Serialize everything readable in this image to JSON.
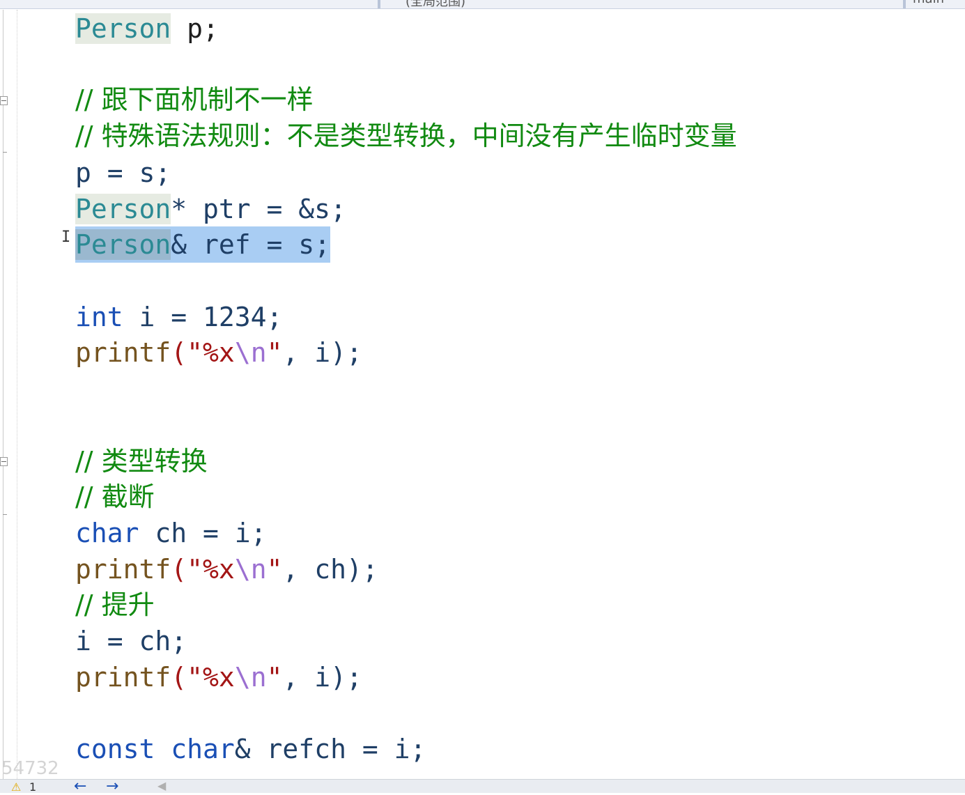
{
  "tabs": {
    "left_partial": "(全局范围)",
    "right_partial": "main"
  },
  "code": {
    "l1": {
      "type": "Person",
      "rest": " p;"
    },
    "l3": {
      "text": "// 跟下面机制不一样"
    },
    "l4": {
      "text": "// 特殊语法规则：不是类型转换，中间没有产生临时变量"
    },
    "l5": {
      "text": "p = s;"
    },
    "l6": {
      "type": "Person",
      "rest": "* ptr = &s;"
    },
    "l7": {
      "type": "Person",
      "rest": "& ref = s;"
    },
    "l9": {
      "kw": "int",
      "rest": " i = 1234;"
    },
    "l10": {
      "fn": "printf",
      "open": "(\"",
      "fmt": "%x",
      "esc": "\\n",
      "close": "\"",
      "tail": ", i);"
    },
    "l13": {
      "text": "// 类型转换"
    },
    "l14": {
      "text": "// 截断"
    },
    "l15": {
      "kw": "char",
      "rest": " ch = i;"
    },
    "l16": {
      "fn": "printf",
      "open": "(\"",
      "fmt": "%x",
      "esc": "\\n",
      "close": "\"",
      "tail": ", ch);"
    },
    "l17": {
      "text": "// 提升"
    },
    "l18": {
      "text": "i = ch;"
    },
    "l19": {
      "fn": "printf",
      "open": "(\"",
      "fmt": "%x",
      "esc": "\\n",
      "close": "\"",
      "tail": ", i);"
    },
    "l21": {
      "kw1": "const",
      "kw2": "char",
      "rest": "& refch = i;"
    }
  },
  "watermark": "54732",
  "status": {
    "warning_count": "1",
    "back_arrow": "←",
    "forward_arrow": "→",
    "caret": "◀"
  },
  "colors": {
    "keyword": "#1a4fb5",
    "type": "#2b8a94",
    "comment": "#118a11",
    "selection": "#a9cdf3"
  }
}
